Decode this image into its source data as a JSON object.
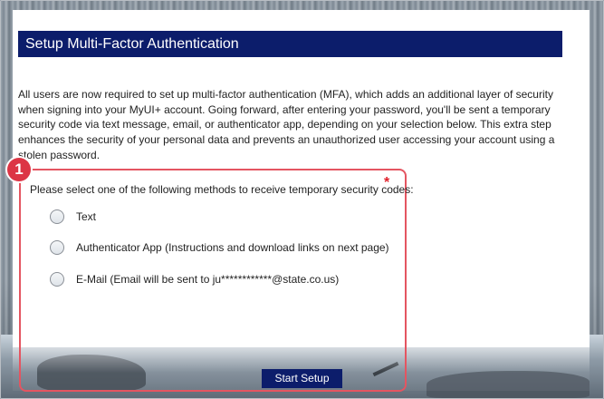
{
  "page": {
    "title": "Setup Multi-Factor Authentication",
    "intro": "All users are now required to set up multi-factor authentication (MFA), which adds an additional layer of security when signing into your MyUI+ account. Going forward, after entering your password, you'll be sent a temporary security code via text message, email, or authenticator app, depending on your selection below. This extra step enhances the security of your personal data and prevents an unauthorized user accessing your account using a stolen password."
  },
  "selection": {
    "prompt": "Please select one of the following methods to receive temporary security codes:",
    "required_marker": "*",
    "options": [
      {
        "label": "Text"
      },
      {
        "label": "Authenticator App (Instructions and download links on next page)"
      },
      {
        "label": "E-Mail (Email will be sent to ju************@state.co.us)"
      }
    ]
  },
  "actions": {
    "start_label": "Start Setup"
  },
  "annotation": {
    "callout_number": "1"
  },
  "colors": {
    "brand": "#0c1d6b",
    "callout": "#dc3545",
    "required": "#e0202a"
  }
}
